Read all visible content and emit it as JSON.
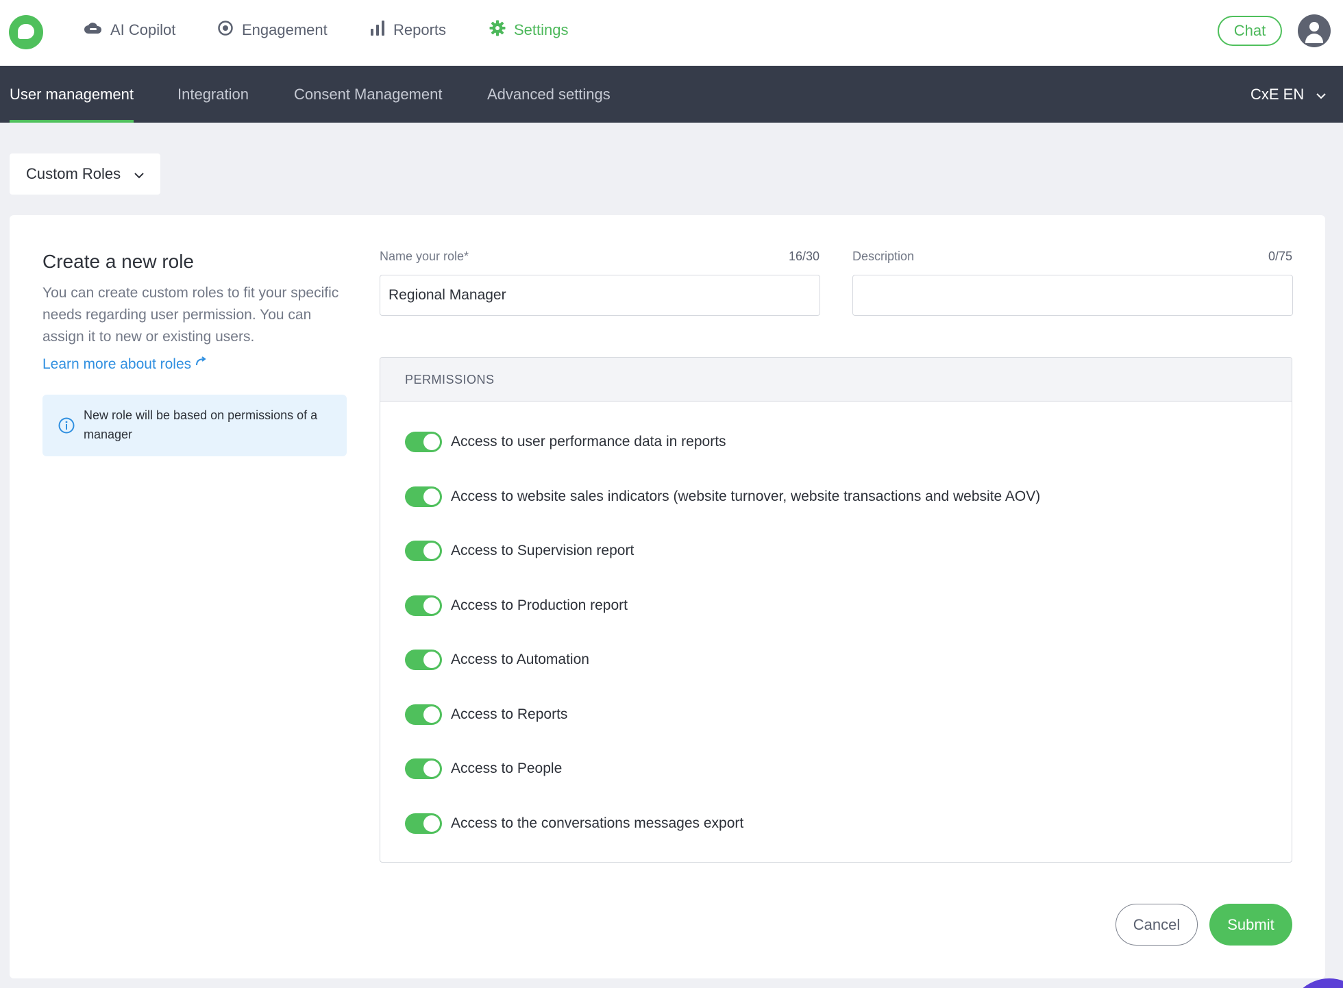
{
  "top_nav": {
    "items": [
      {
        "label": "AI Copilot",
        "icon": "cloud-icon"
      },
      {
        "label": "Engagement",
        "icon": "target-icon"
      },
      {
        "label": "Reports",
        "icon": "bar-chart-icon"
      },
      {
        "label": "Settings",
        "icon": "gear-icon",
        "active": true
      }
    ],
    "chat_label": "Chat"
  },
  "sub_nav": {
    "tabs": [
      {
        "label": "User management",
        "active": true
      },
      {
        "label": "Integration"
      },
      {
        "label": "Consent Management"
      },
      {
        "label": "Advanced settings"
      }
    ],
    "language": "CxE EN"
  },
  "roles_dropdown": {
    "selected": "Custom Roles"
  },
  "create_role": {
    "title": "Create a new role",
    "description": "You can create custom roles to fit your specific needs regarding user permission. You can assign it to new or existing users.",
    "learn_more": "Learn more about roles",
    "info": "New role will be based on permissions of a manager"
  },
  "form": {
    "name_label": "Name your role*",
    "name_count": "16/30",
    "name_value": "Regional Manager",
    "description_label": "Description",
    "description_count": "0/75",
    "description_value": ""
  },
  "permissions": {
    "header": "PERMISSIONS",
    "items": [
      {
        "label": "Access to user performance data in reports",
        "enabled": true
      },
      {
        "label": "Access to website sales indicators (website turnover, website transactions and website AOV)",
        "enabled": true
      },
      {
        "label": "Access to Supervision report",
        "enabled": true
      },
      {
        "label": "Access to Production report",
        "enabled": true
      },
      {
        "label": "Access to Automation",
        "enabled": true
      },
      {
        "label": "Access to Reports",
        "enabled": true
      },
      {
        "label": "Access to People",
        "enabled": true
      },
      {
        "label": "Access to the conversations messages export",
        "enabled": true
      }
    ]
  },
  "actions": {
    "cancel": "Cancel",
    "submit": "Submit"
  },
  "colors": {
    "accent": "#4fc05c",
    "nav_dark": "#363c4a",
    "link": "#2f8fe0",
    "info_bg": "#e7f3fd"
  }
}
